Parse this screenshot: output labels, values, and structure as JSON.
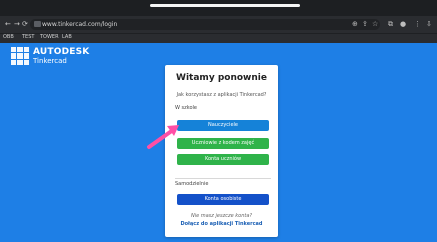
{
  "browser": {
    "url": "www.tinkercad.com/login",
    "bookmarks": [
      "OBB",
      "TEST",
      "TOWER",
      "LAB"
    ]
  },
  "brand": {
    "name_line1": "AUTODESK",
    "name_line2": "Tinkercad"
  },
  "card": {
    "title": "Witamy ponownie",
    "question": "Jak korzystasz z aplikacji Tinkercad?",
    "school_section": "W szkole",
    "teachers_button": "Nauczyciele",
    "student_class_button": "Uczniowie z kodem zajęć",
    "student_account_button": "Konta uczniów",
    "personal_section": "Samodzielnie",
    "personal_button": "Konta osobiste",
    "no_account_text": "Nie masz jeszcze konta?",
    "join_link": "Dołącz do aplikacji Tinkercad"
  },
  "colors": {
    "background": "#1e7fe6",
    "teachers": "#1582d8",
    "green": "#2fb34a",
    "personal": "#1451c9",
    "arrow": "#ff4fa6"
  }
}
